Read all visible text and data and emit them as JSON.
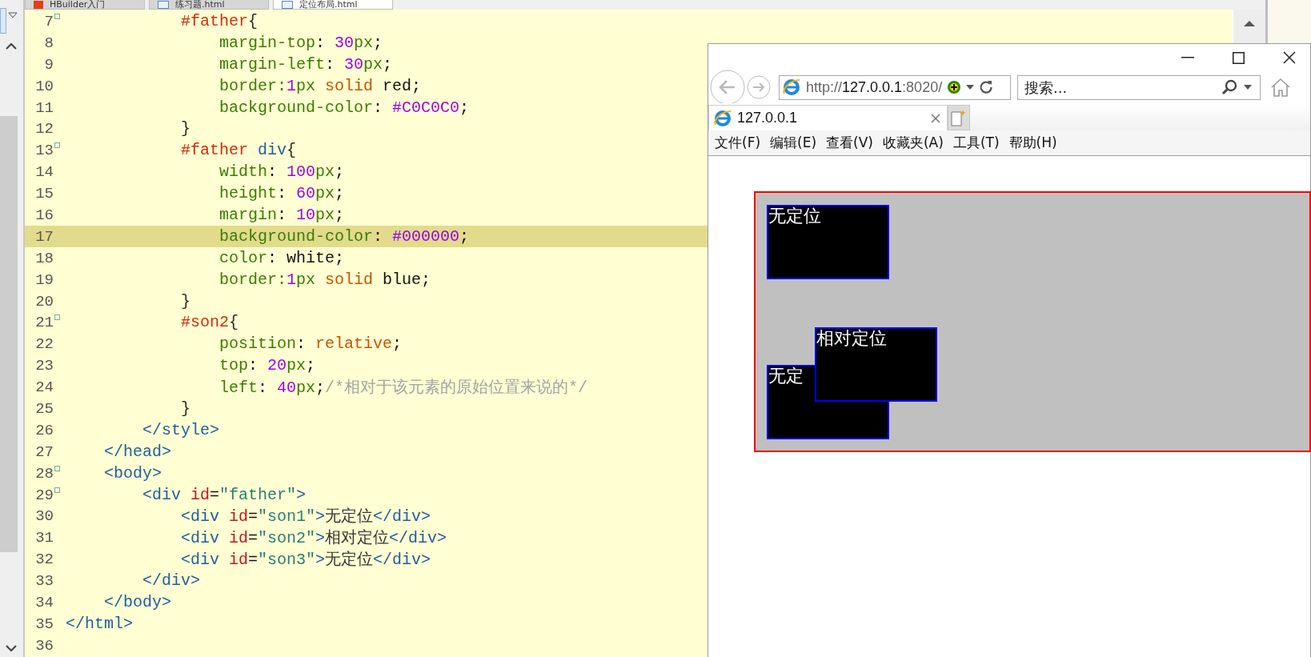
{
  "editor_tabs": [
    {
      "label": "HBuilder入门",
      "selected": false,
      "kind": "app"
    },
    {
      "label": "练习题.html",
      "selected": false,
      "kind": "file"
    },
    {
      "label": "定位布局.html",
      "selected": true,
      "kind": "file"
    }
  ],
  "code_lines": [
    {
      "number": "7",
      "foldable": true,
      "current": false,
      "tokens": [
        {
          "kind": "sel",
          "text": "            #father"
        },
        {
          "kind": "brace",
          "text": "{"
        }
      ]
    },
    {
      "number": "8",
      "foldable": false,
      "current": false,
      "tokens": [
        {
          "kind": "prop",
          "text": "                margin-top"
        },
        {
          "kind": "plain",
          "text": ": "
        },
        {
          "kind": "num",
          "text": "30"
        },
        {
          "kind": "prop",
          "text": "px"
        },
        {
          "kind": "plain",
          "text": ";"
        }
      ]
    },
    {
      "number": "9",
      "foldable": false,
      "current": false,
      "tokens": [
        {
          "kind": "prop",
          "text": "                margin-left"
        },
        {
          "kind": "plain",
          "text": ": "
        },
        {
          "kind": "num",
          "text": "30"
        },
        {
          "kind": "prop",
          "text": "px"
        },
        {
          "kind": "plain",
          "text": ";"
        }
      ]
    },
    {
      "number": "10",
      "foldable": false,
      "current": false,
      "tokens": [
        {
          "kind": "prop",
          "text": "                border:"
        },
        {
          "kind": "num",
          "text": "1"
        },
        {
          "kind": "prop",
          "text": "px "
        },
        {
          "kind": "kw",
          "text": "solid"
        },
        {
          "kind": "plain",
          "text": " red;"
        }
      ]
    },
    {
      "number": "11",
      "foldable": false,
      "current": false,
      "tokens": [
        {
          "kind": "prop",
          "text": "                background-color"
        },
        {
          "kind": "plain",
          "text": ": "
        },
        {
          "kind": "num",
          "text": "#C0C0C0"
        },
        {
          "kind": "plain",
          "text": ";"
        }
      ]
    },
    {
      "number": "12",
      "foldable": false,
      "current": false,
      "tokens": [
        {
          "kind": "brace",
          "text": "            }"
        }
      ]
    },
    {
      "number": "13",
      "foldable": true,
      "current": false,
      "tokens": [
        {
          "kind": "sel",
          "text": "            #father "
        },
        {
          "kind": "tag",
          "text": "div"
        },
        {
          "kind": "brace",
          "text": "{"
        }
      ]
    },
    {
      "number": "14",
      "foldable": false,
      "current": false,
      "tokens": [
        {
          "kind": "prop",
          "text": "                width"
        },
        {
          "kind": "plain",
          "text": ": "
        },
        {
          "kind": "num",
          "text": "100"
        },
        {
          "kind": "prop",
          "text": "px"
        },
        {
          "kind": "plain",
          "text": ";"
        }
      ]
    },
    {
      "number": "15",
      "foldable": false,
      "current": false,
      "tokens": [
        {
          "kind": "prop",
          "text": "                height"
        },
        {
          "kind": "plain",
          "text": ": "
        },
        {
          "kind": "num",
          "text": "60"
        },
        {
          "kind": "prop",
          "text": "px"
        },
        {
          "kind": "plain",
          "text": ";"
        }
      ]
    },
    {
      "number": "16",
      "foldable": false,
      "current": false,
      "tokens": [
        {
          "kind": "prop",
          "text": "                margin"
        },
        {
          "kind": "plain",
          "text": ": "
        },
        {
          "kind": "num",
          "text": "10"
        },
        {
          "kind": "prop",
          "text": "px"
        },
        {
          "kind": "plain",
          "text": ";"
        }
      ]
    },
    {
      "number": "17",
      "foldable": false,
      "current": true,
      "tokens": [
        {
          "kind": "prop",
          "text": "                background-color"
        },
        {
          "kind": "plain",
          "text": ": "
        },
        {
          "kind": "num",
          "text": "#000000"
        },
        {
          "kind": "plain",
          "text": ";"
        }
      ]
    },
    {
      "number": "18",
      "foldable": false,
      "current": false,
      "tokens": [
        {
          "kind": "prop",
          "text": "                color"
        },
        {
          "kind": "plain",
          "text": ": white;"
        }
      ]
    },
    {
      "number": "19",
      "foldable": false,
      "current": false,
      "tokens": [
        {
          "kind": "prop",
          "text": "                border:"
        },
        {
          "kind": "num",
          "text": "1"
        },
        {
          "kind": "prop",
          "text": "px "
        },
        {
          "kind": "kw",
          "text": "solid"
        },
        {
          "kind": "plain",
          "text": " blue;"
        }
      ]
    },
    {
      "number": "20",
      "foldable": false,
      "current": false,
      "tokens": [
        {
          "kind": "brace",
          "text": "            }"
        }
      ]
    },
    {
      "number": "21",
      "foldable": true,
      "current": false,
      "tokens": [
        {
          "kind": "sel",
          "text": "            #son2"
        },
        {
          "kind": "brace",
          "text": "{"
        }
      ]
    },
    {
      "number": "22",
      "foldable": false,
      "current": false,
      "tokens": [
        {
          "kind": "prop",
          "text": "                position"
        },
        {
          "kind": "plain",
          "text": ": "
        },
        {
          "kind": "kw",
          "text": "relative"
        },
        {
          "kind": "plain",
          "text": ";"
        }
      ]
    },
    {
      "number": "23",
      "foldable": false,
      "current": false,
      "tokens": [
        {
          "kind": "prop",
          "text": "                top"
        },
        {
          "kind": "plain",
          "text": ": "
        },
        {
          "kind": "num",
          "text": "20"
        },
        {
          "kind": "prop",
          "text": "px"
        },
        {
          "kind": "plain",
          "text": ";"
        }
      ]
    },
    {
      "number": "24",
      "foldable": false,
      "current": false,
      "tokens": [
        {
          "kind": "prop",
          "text": "                left"
        },
        {
          "kind": "plain",
          "text": ": "
        },
        {
          "kind": "num",
          "text": "40"
        },
        {
          "kind": "prop",
          "text": "px"
        },
        {
          "kind": "plain",
          "text": ";"
        },
        {
          "kind": "comment",
          "text": "/*相对于该元素的原始位置来说的*/"
        }
      ]
    },
    {
      "number": "25",
      "foldable": false,
      "current": false,
      "tokens": [
        {
          "kind": "brace",
          "text": "            }"
        }
      ]
    },
    {
      "number": "26",
      "foldable": false,
      "current": false,
      "tokens": [
        {
          "kind": "tag",
          "text": "        </style>"
        }
      ]
    },
    {
      "number": "27",
      "foldable": false,
      "current": false,
      "tokens": [
        {
          "kind": "tag",
          "text": "    </head>"
        }
      ]
    },
    {
      "number": "28",
      "foldable": true,
      "current": false,
      "tokens": [
        {
          "kind": "tag",
          "text": "    <body>"
        }
      ]
    },
    {
      "number": "29",
      "foldable": true,
      "current": false,
      "tokens": [
        {
          "kind": "tag",
          "text": "        <div "
        },
        {
          "kind": "attr",
          "text": "id"
        },
        {
          "kind": "plain",
          "text": "="
        },
        {
          "kind": "str",
          "text": "\"father\""
        },
        {
          "kind": "tag",
          "text": ">"
        }
      ]
    },
    {
      "number": "30",
      "foldable": false,
      "current": false,
      "tokens": [
        {
          "kind": "tag",
          "text": "            <div "
        },
        {
          "kind": "attr",
          "text": "id"
        },
        {
          "kind": "plain",
          "text": "="
        },
        {
          "kind": "str",
          "text": "\"son1\""
        },
        {
          "kind": "tag",
          "text": ">"
        },
        {
          "kind": "text",
          "text": "无定位"
        },
        {
          "kind": "tag",
          "text": "</div>"
        }
      ]
    },
    {
      "number": "31",
      "foldable": false,
      "current": false,
      "tokens": [
        {
          "kind": "tag",
          "text": "            <div "
        },
        {
          "kind": "attr",
          "text": "id"
        },
        {
          "kind": "plain",
          "text": "="
        },
        {
          "kind": "str",
          "text": "\"son2\""
        },
        {
          "kind": "tag",
          "text": ">"
        },
        {
          "kind": "text",
          "text": "相对定位"
        },
        {
          "kind": "tag",
          "text": "</div>"
        }
      ]
    },
    {
      "number": "32",
      "foldable": false,
      "current": false,
      "tokens": [
        {
          "kind": "tag",
          "text": "            <div "
        },
        {
          "kind": "attr",
          "text": "id"
        },
        {
          "kind": "plain",
          "text": "="
        },
        {
          "kind": "str",
          "text": "\"son3\""
        },
        {
          "kind": "tag",
          "text": ">"
        },
        {
          "kind": "text",
          "text": "无定位"
        },
        {
          "kind": "tag",
          "text": "</div>"
        }
      ]
    },
    {
      "number": "33",
      "foldable": false,
      "current": false,
      "tokens": [
        {
          "kind": "tag",
          "text": "        </div>"
        }
      ]
    },
    {
      "number": "34",
      "foldable": false,
      "current": false,
      "tokens": [
        {
          "kind": "tag",
          "text": "    </body>"
        }
      ]
    },
    {
      "number": "35",
      "foldable": false,
      "current": false,
      "tokens": [
        {
          "kind": "tag",
          "text": "</html>"
        }
      ]
    },
    {
      "number": "36",
      "foldable": false,
      "current": false
    }
  ],
  "browser": {
    "address": [
      {
        "text": "http://",
        "strong": false
      },
      {
        "text": "127.0.0.1",
        "strong": true
      },
      {
        "text": ":8020/",
        "strong": false
      }
    ],
    "search": {
      "placeholder": "搜索..."
    },
    "tabs": [
      {
        "label": "127.0.0.1",
        "selected": true
      }
    ],
    "menu": [
      "文件(F)",
      "编辑(E)",
      "查看(V)",
      "收藏夹(A)",
      "工具(T)",
      "帮助(H)"
    ],
    "page": {
      "boxes": [
        {
          "label": "无定位",
          "kind": "static"
        },
        {
          "label": "相对定位",
          "kind": "relative"
        },
        {
          "label": "无定",
          "kind": "static"
        }
      ]
    }
  }
}
